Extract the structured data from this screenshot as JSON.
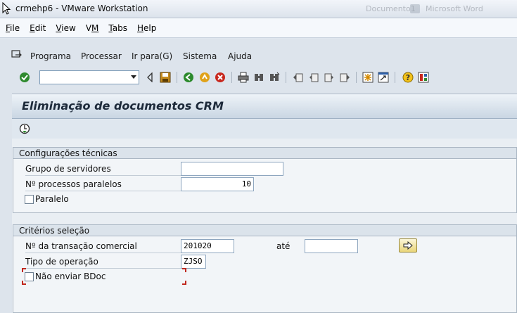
{
  "window": {
    "title": "crmehp6 - VMware Workstation",
    "background_titles": [
      "Documento1",
      "Microsoft Word"
    ]
  },
  "vm_menu": [
    {
      "label": "File",
      "mnemonic": "F",
      "rest": "ile"
    },
    {
      "label": "Edit",
      "mnemonic": "E",
      "rest": "dit"
    },
    {
      "label": "View",
      "mnemonic": "V",
      "rest": "iew"
    },
    {
      "label": "VM",
      "mnemonic": "V",
      "rest": "M"
    },
    {
      "label": "Tabs",
      "mnemonic": "T",
      "rest": "abs"
    },
    {
      "label": "Help",
      "mnemonic": "H",
      "rest": "elp"
    }
  ],
  "sap_menu": {
    "programa": "Programa",
    "processar": "Processar",
    "ir_para": "Ir para(G)",
    "sistema": "Sistema",
    "ajuda": "Ajuda"
  },
  "toolbar": {
    "command_field_value": "",
    "icons": [
      "enter-icon",
      "back-arrow-icon",
      "save-icon",
      "back-icon",
      "exit-icon",
      "cancel-icon",
      "print-icon",
      "find-icon",
      "find-next-icon",
      "first-page-icon",
      "previous-page-icon",
      "next-page-icon",
      "last-page-icon",
      "new-session-icon",
      "shortcut-icon",
      "help-icon",
      "layout-icon"
    ]
  },
  "screen": {
    "title": "Eliminação de documentos CRM"
  },
  "tech_settings": {
    "header": "Configurações técnicas",
    "server_group_label": "Grupo de servidores",
    "server_group_value": "",
    "parallel_processes_label": "Nº processos paralelos",
    "parallel_processes_value": "10",
    "parallel_label": "Paralelo",
    "parallel_checked": false
  },
  "selection": {
    "header": "Critérios seleção",
    "transaction_label": "Nº da transação comercial",
    "transaction_from": "201020",
    "to_label": "até",
    "transaction_to": "",
    "operation_type_label": "Tipo de operação",
    "operation_type_value": "ZJSO",
    "no_bdoc_label": "Não enviar BDoc",
    "no_bdoc_checked": false
  },
  "colors": {
    "screen_background": "#dde4ec",
    "header_gradient_bottom": "#c9d6e3",
    "focus_corner": "#c0281e"
  }
}
